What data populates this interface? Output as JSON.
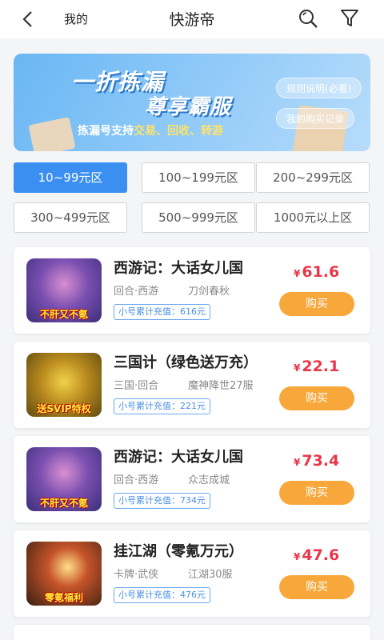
{
  "header": {
    "back_label": "",
    "mine_label": "我的",
    "title": "快游帝"
  },
  "banner": {
    "headline_1": "一折拣漏",
    "headline_2": "尊享霸服",
    "subline_prefix": "拣漏号支持",
    "subline_em": "交易、回收、转游",
    "rules_label": "规则说明(必看)",
    "records_label": "我的购买记录"
  },
  "ranges": [
    {
      "label": "10~99元区",
      "active": true
    },
    {
      "label": "100~199元区",
      "active": false
    },
    {
      "label": "200~299元区",
      "active": false
    },
    {
      "label": "300~499元区",
      "active": false
    },
    {
      "label": "500~999元区",
      "active": false
    },
    {
      "label": "1000元以上区",
      "active": false
    }
  ],
  "listings": [
    {
      "name": "西游记：大话女儿国",
      "tags": "回合·西游",
      "server": "刀剑春秋",
      "recharge": "小号累计充值：616元",
      "currency": "¥",
      "price": "61.6",
      "buy_label": "购买",
      "thumb_caption": "不肝又不氪",
      "thumb_color": "#3b2f7a"
    },
    {
      "name": "三国计（绿色送万充）",
      "tags": "三国·回合",
      "server": "魔神降世27服",
      "recharge": "小号累计充值：221元",
      "currency": "¥",
      "price": "22.1",
      "buy_label": "购买",
      "thumb_caption": "送SVIP特权",
      "thumb_color": "#5f4b12"
    },
    {
      "name": "西游记：大话女儿国",
      "tags": "回合·西游",
      "server": "众志成城",
      "recharge": "小号累计充值：734元",
      "currency": "¥",
      "price": "73.4",
      "buy_label": "购买",
      "thumb_caption": "不肝又不氪",
      "thumb_color": "#3b2f7a"
    },
    {
      "name": "挂江湖（零氪万元）",
      "tags": "卡牌·武侠",
      "server": "江湖30服",
      "recharge": "小号累计充值：476元",
      "currency": "¥",
      "price": "47.6",
      "buy_label": "购买",
      "thumb_caption": "零氪福利",
      "thumb_color": "#3a1f12"
    }
  ],
  "colors": {
    "accent": "#3a8ff0",
    "price": "#e8364a",
    "buy": "#f8a73a"
  }
}
